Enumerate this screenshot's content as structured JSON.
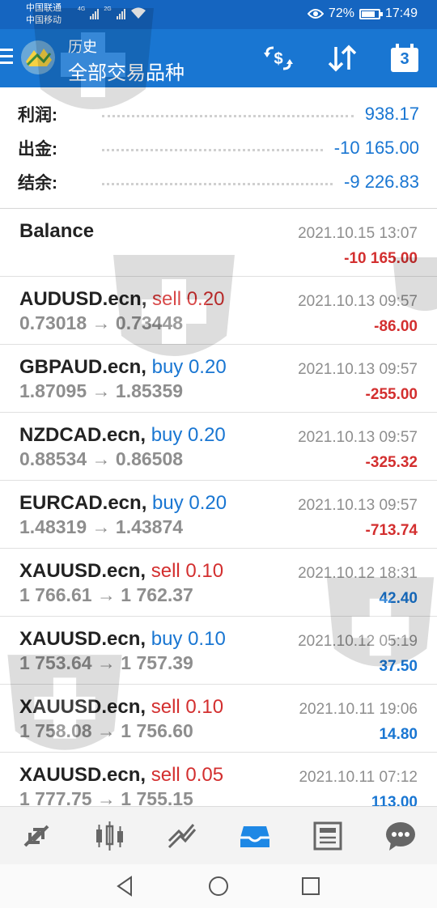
{
  "status_bar": {
    "carrier1": "中国联通",
    "carrier2": "中国移动",
    "net1": "4G",
    "net2": "2G",
    "battery_percent": "72%",
    "battery_level": 0.72,
    "time": "17:49"
  },
  "app_bar": {
    "title": "历史",
    "subtitle": "全部交易品种",
    "calendar_day": "3"
  },
  "summary": [
    {
      "label": "利润:",
      "value": "938.17"
    },
    {
      "label": "出金:",
      "value": "-10 165.00"
    },
    {
      "label": "结余:",
      "value": "-9 226.83"
    }
  ],
  "history": [
    {
      "symbol": "Balance",
      "side_text": "",
      "side": "",
      "prices": "",
      "date": "2021.10.15 13:07",
      "profit": "-10 165.00",
      "profit_sign": "neg"
    },
    {
      "symbol": "AUDUSD.ecn,",
      "side_text": "sell 0.20",
      "side": "sell",
      "prices": "0.73018 → 0.73448",
      "date": "2021.10.13 09:57",
      "profit": "-86.00",
      "profit_sign": "neg"
    },
    {
      "symbol": "GBPAUD.ecn,",
      "side_text": "buy 0.20",
      "side": "buy",
      "prices": "1.87095 → 1.85359",
      "date": "2021.10.13 09:57",
      "profit": "-255.00",
      "profit_sign": "neg"
    },
    {
      "symbol": "NZDCAD.ecn,",
      "side_text": "buy 0.20",
      "side": "buy",
      "prices": "0.88534 → 0.86508",
      "date": "2021.10.13 09:57",
      "profit": "-325.32",
      "profit_sign": "neg"
    },
    {
      "symbol": "EURCAD.ecn,",
      "side_text": "buy 0.20",
      "side": "buy",
      "prices": "1.48319 → 1.43874",
      "date": "2021.10.13 09:57",
      "profit": "-713.74",
      "profit_sign": "neg"
    },
    {
      "symbol": "XAUUSD.ecn,",
      "side_text": "sell 0.10",
      "side": "sell",
      "prices": "1 766.61 → 1 762.37",
      "date": "2021.10.12 18:31",
      "profit": "42.40",
      "profit_sign": "pos"
    },
    {
      "symbol": "XAUUSD.ecn,",
      "side_text": "buy 0.10",
      "side": "buy",
      "prices": "1 753.64 → 1 757.39",
      "date": "2021.10.12 05:19",
      "profit": "37.50",
      "profit_sign": "pos"
    },
    {
      "symbol": "XAUUSD.ecn,",
      "side_text": "sell 0.10",
      "side": "sell",
      "prices": "1 758.08 → 1 756.60",
      "date": "2021.10.11 19:06",
      "profit": "14.80",
      "profit_sign": "pos"
    },
    {
      "symbol": "XAUUSD.ecn,",
      "side_text": "sell 0.05",
      "side": "sell",
      "prices": "1 777.75 → 1 755.15",
      "date": "2021.10.11 07:12",
      "profit": "113.00",
      "profit_sign": "pos"
    }
  ],
  "toolbar": {
    "items": [
      "quotes-icon",
      "chart-icon",
      "trade-icon",
      "history-icon",
      "news-icon",
      "chat-icon"
    ],
    "active": "history-icon"
  },
  "colors": {
    "appbar": "#1976d2",
    "statusbar": "#1565c0",
    "loss": "#d32f2f",
    "gain": "#1976d2",
    "muted": "#8e8e8e"
  }
}
